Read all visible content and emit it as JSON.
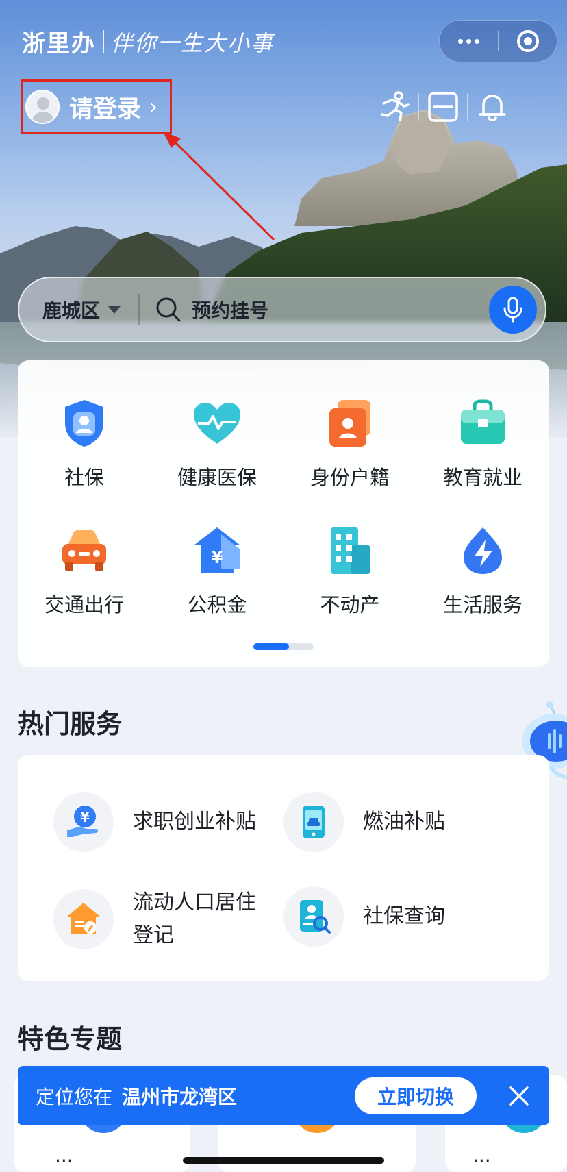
{
  "header": {
    "app_name": "浙里办",
    "slogan": "伴你一生大小事",
    "login_label": "请登录",
    "login_chevron": "›"
  },
  "capsule": {
    "more_icon": "more-dots-icon",
    "close_icon": "target-icon"
  },
  "top_icons": [
    "sport-runner-icon",
    "scan-icon",
    "bell-icon"
  ],
  "search": {
    "region": "鹿城区",
    "placeholder": "预约挂号",
    "voice_icon": "microphone-icon"
  },
  "categories": [
    {
      "label": "社保",
      "icon": "shield-person-icon"
    },
    {
      "label": "健康医保",
      "icon": "heart-pulse-icon"
    },
    {
      "label": "身份户籍",
      "icon": "id-card-icon"
    },
    {
      "label": "教育就业",
      "icon": "briefcase-icon"
    },
    {
      "label": "交通出行",
      "icon": "car-icon"
    },
    {
      "label": "公积金",
      "icon": "house-yuan-icon"
    },
    {
      "label": "不动产",
      "icon": "building-icon"
    },
    {
      "label": "生活服务",
      "icon": "lightning-drop-icon"
    }
  ],
  "pager": {
    "active_index": 0,
    "page_count": 2
  },
  "hot_services": {
    "title": "热门服务",
    "items": [
      {
        "label": "求职创业补贴",
        "icon": "yuan-hand-icon"
      },
      {
        "label": "燃油补贴",
        "icon": "phone-car-icon"
      },
      {
        "label_line1": "流动人口居住",
        "label_line2": "登记",
        "icon": "house-edit-icon"
      },
      {
        "label": "社保查询",
        "icon": "person-search-icon"
      }
    ]
  },
  "featured": {
    "title": "特色专题",
    "peek_items": [
      "...",
      "...",
      "..."
    ]
  },
  "location_banner": {
    "prefix": "定位您在",
    "city": "温州市龙湾区",
    "switch_label": "立即切换",
    "close_icon": "close-icon"
  },
  "colors": {
    "primary": "#1a6ef5",
    "highlight_box": "#e0271f"
  }
}
